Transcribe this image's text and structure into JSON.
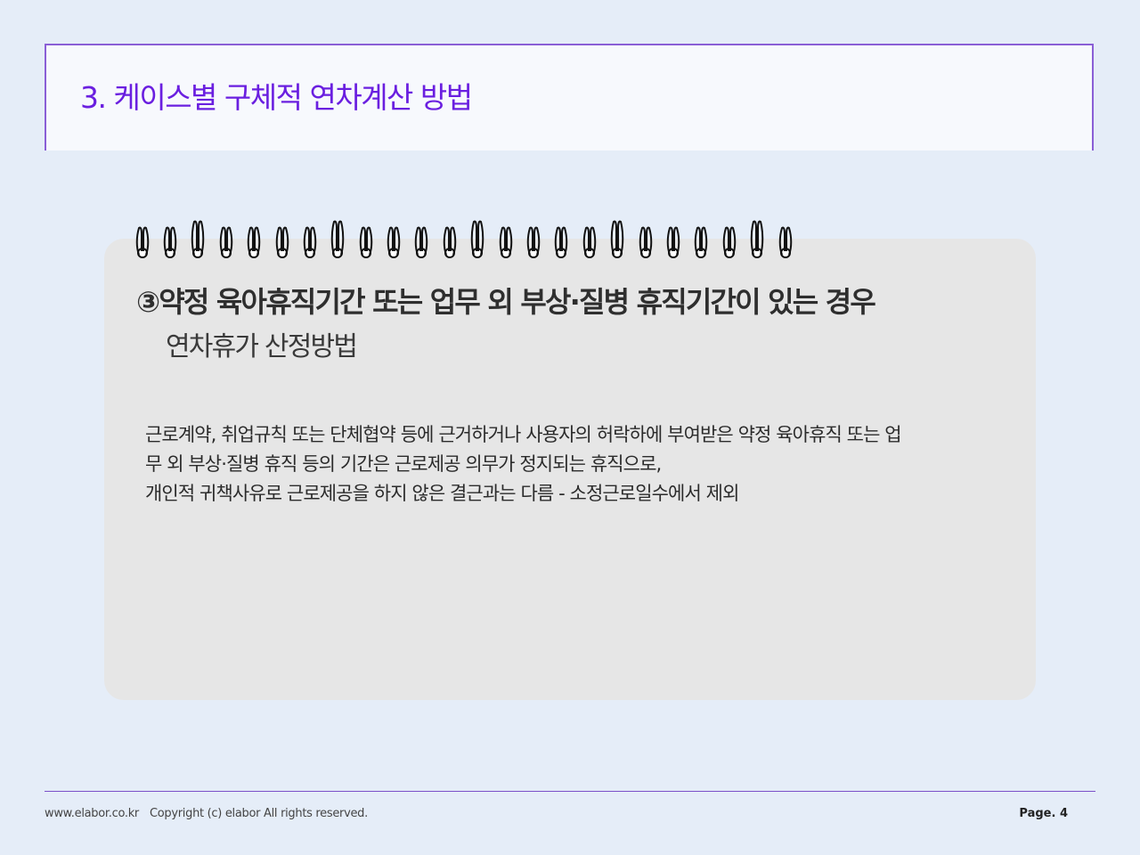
{
  "header": {
    "title": "3. 케이스별 구체적 연차계산 방법"
  },
  "card": {
    "heading": "③약정 육아휴직기간 또는 업무 외 부상·질병 휴직기간이 있는 경우",
    "subheading": "연차휴가 산정방법",
    "body_lines": [
      "근로계약, 취업규칙 또는 단체협약 등에 근거하거나 사용자의 허락하에 부여받은 약정 육아휴직 또는 업",
      "무 외 부상·질병 휴직 등의 기간은 근로제공 의무가 정지되는 휴직으로,",
      "개인적 귀책사유로 근로제공을 하지 않은 결근과는 다름 - 소정근로일수에서 제외"
    ]
  },
  "footer": {
    "site": "www.elabor.co.kr",
    "copyright": "Copyright (c) elabor All rights reserved.",
    "page_label": "Page. 4"
  },
  "colors": {
    "accent": "#6a1fe0",
    "border": "#8a5fd6",
    "background": "#e5edf8",
    "card": "#e6e6e6"
  },
  "icons": {
    "spiral_binding": "spiral-ring-icon"
  }
}
